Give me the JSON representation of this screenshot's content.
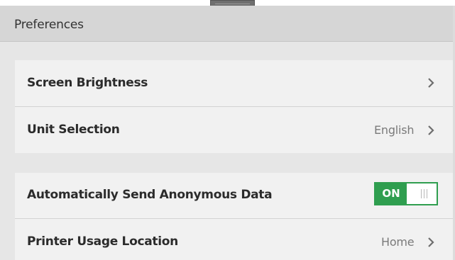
{
  "header": {
    "title": "Preferences"
  },
  "groups": [
    {
      "items": [
        {
          "label": "Screen Brightness",
          "value": ""
        },
        {
          "label": "Unit Selection",
          "value": "English"
        }
      ]
    },
    {
      "items": [
        {
          "label": "Automatically Send Anonymous Data",
          "toggle": {
            "state_label": "ON",
            "on": true
          }
        },
        {
          "label": "Printer Usage Location",
          "value": "Home"
        }
      ]
    }
  ],
  "colors": {
    "accent": "#2f9e4f",
    "header_bg": "#d6d6d6",
    "row_bg": "#f1f1f1",
    "page_bg": "#e6e6e6"
  },
  "icons": {
    "chevron": "chevron-right-icon",
    "handle": "drag-handle-icon",
    "toggle_grip": "toggle-grip-icon"
  }
}
